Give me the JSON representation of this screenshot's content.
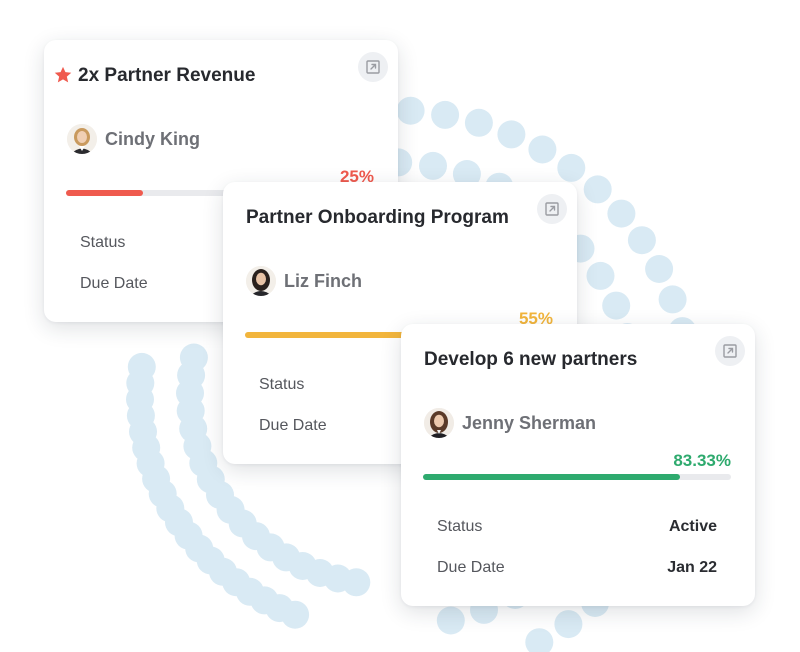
{
  "colors": {
    "dot": "#d9eaf4",
    "track": "#e9eaed",
    "star": "#ef5a4e"
  },
  "cards": [
    {
      "title": "2x Partner Revenue",
      "starred": true,
      "owner": "Cindy King",
      "progress_label": "25%",
      "progress": 0.25,
      "accent": "#ef5a4e",
      "status_label": "Status",
      "status_value": "",
      "due_label": "Due Date",
      "due_value": "",
      "icons": [
        "star-icon",
        "open-external-icon"
      ]
    },
    {
      "title": "Partner Onboarding Program",
      "starred": false,
      "owner": "Liz Finch",
      "progress_label": "55%",
      "progress": 0.55,
      "accent": "#f2b53c",
      "status_label": "Status",
      "status_value": "",
      "due_label": "Due Date",
      "due_value": "",
      "icons": [
        "open-external-icon"
      ]
    },
    {
      "title": "Develop 6 new partners",
      "starred": false,
      "owner": "Jenny Sherman",
      "progress_label": "83.33%",
      "progress": 0.8333,
      "accent": "#2eaa6e",
      "status_label": "Status",
      "status_value": "Active",
      "due_label": "Due Date",
      "due_value": "Jan 22",
      "icons": [
        "open-external-icon"
      ]
    }
  ]
}
